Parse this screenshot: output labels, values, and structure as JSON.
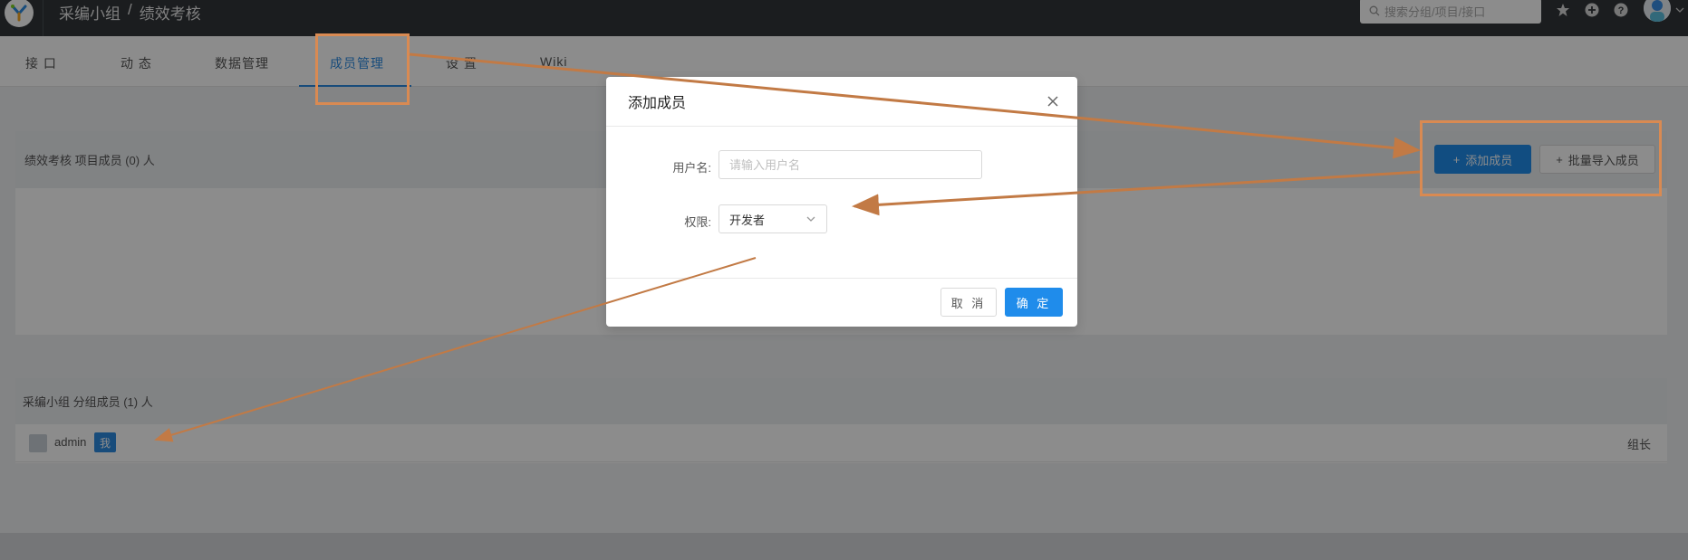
{
  "header": {
    "breadcrumb_group": "采编小组",
    "breadcrumb_sep": "/",
    "breadcrumb_project": "绩效考核",
    "search_placeholder": "搜索分组/项目/接口"
  },
  "tabs": [
    {
      "label": "接 口"
    },
    {
      "label": "动 态"
    },
    {
      "label": "数据管理"
    },
    {
      "label": "成员管理",
      "active": true
    },
    {
      "label": "设 置"
    },
    {
      "label": "Wiki"
    }
  ],
  "project_members": {
    "title": "绩效考核 项目成员 (0) 人",
    "add_button": "添加成员",
    "import_button": "批量导入成员"
  },
  "group_members": {
    "title": "采编小组 分组成员 (1) 人",
    "rows": [
      {
        "name": "admin",
        "badge": "我",
        "role": "组长"
      }
    ]
  },
  "modal": {
    "title": "添加成员",
    "username_label": "用户名:",
    "username_placeholder": "请输入用户名",
    "permission_label": "权限:",
    "permission_value": "开发者",
    "cancel_label": "取 消",
    "ok_label": "确 定"
  },
  "colors": {
    "primary": "#1f8ceb",
    "annotation": "#d98a52",
    "header_bg": "#32363a"
  }
}
